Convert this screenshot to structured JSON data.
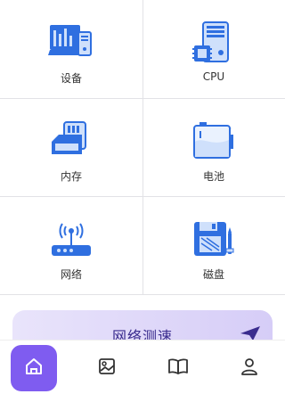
{
  "grid": {
    "items": [
      {
        "label": "设备",
        "icon": "device-icon"
      },
      {
        "label": "CPU",
        "icon": "cpu-icon"
      },
      {
        "label": "内存",
        "icon": "memory-icon"
      },
      {
        "label": "电池",
        "icon": "battery-icon"
      },
      {
        "label": "网络",
        "icon": "network-icon"
      },
      {
        "label": "磁盘",
        "icon": "disk-icon"
      }
    ]
  },
  "speed_test": {
    "label": "网络测速",
    "icon": "send-icon"
  },
  "nav": {
    "items": [
      {
        "icon": "home-icon",
        "active": true
      },
      {
        "icon": "image-icon",
        "active": false
      },
      {
        "icon": "book-icon",
        "active": false
      },
      {
        "icon": "user-icon",
        "active": false
      }
    ]
  },
  "colors": {
    "accent": "#7f5cf0",
    "icon_blue": "#2f6fe0",
    "icon_light": "#cfe0fb"
  }
}
